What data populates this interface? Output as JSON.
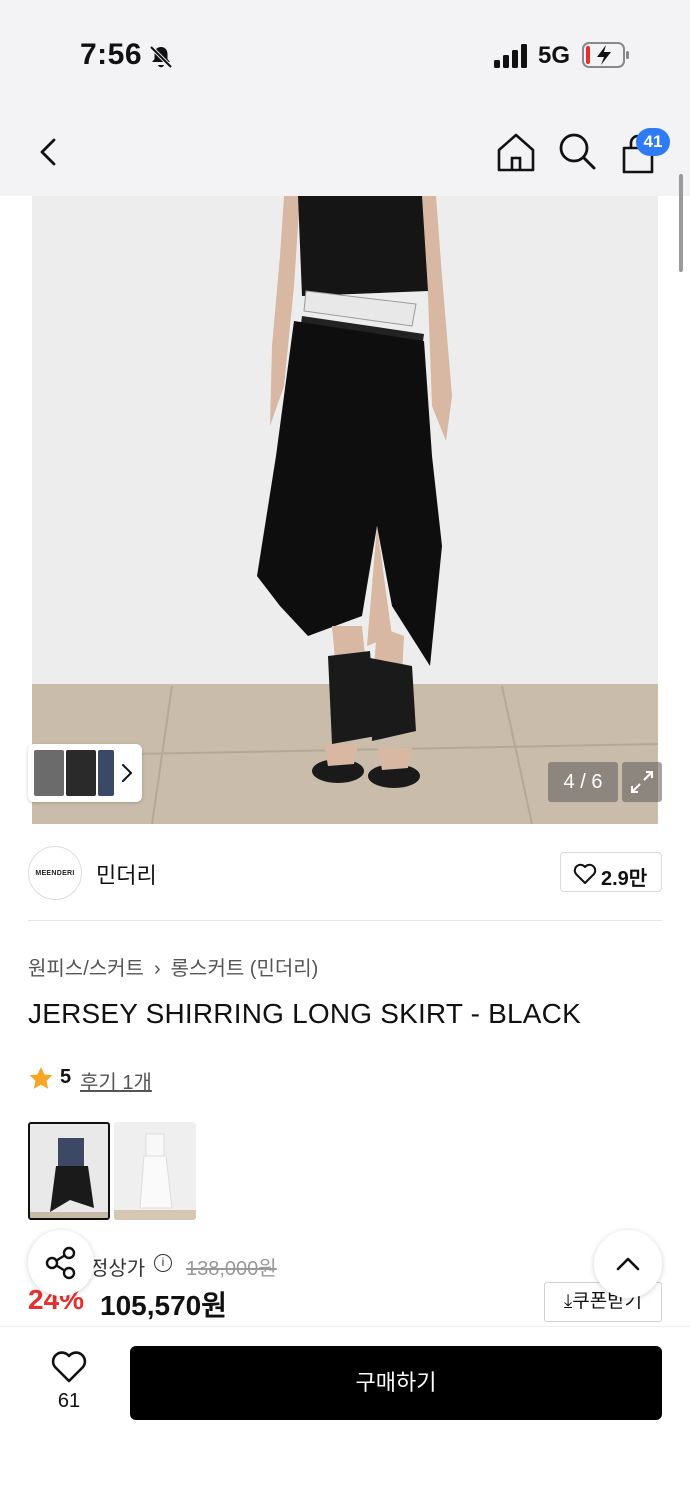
{
  "status_bar": {
    "time": "7:56",
    "network": "5G"
  },
  "nav": {
    "cart_count": "41"
  },
  "gallery": {
    "page_indicator": "4 / 6"
  },
  "brand": {
    "logo_text": "MEENDERI",
    "name": "민더리",
    "likes": "2.9만"
  },
  "breadcrumb": {
    "category": "원피스/스커트",
    "subcategory": "롱스커트 (민더리)"
  },
  "product": {
    "title": "JERSEY SHIRRING LONG SKIRT - BLACK",
    "rating": "5",
    "review_link": "후기 1개",
    "price_label": "정상가",
    "original_price": "138,000원",
    "discount": "24%",
    "sale_price": "105,570원",
    "coupon_label": "쿠폰받기"
  },
  "bottom_bar": {
    "like_count": "61",
    "buy_label": "구매하기"
  },
  "colors": {
    "accent_blue": "#2f7bf6",
    "discount_red": "#e62e2e",
    "star": "#f5a623",
    "buy_button": "#000000"
  },
  "icons": [
    "back-chevron-icon",
    "home-icon",
    "search-icon",
    "shopping-bag-icon",
    "heart-icon",
    "share-icon",
    "chevron-up-icon",
    "expand-icon",
    "star-icon",
    "info-icon",
    "download-icon"
  ]
}
